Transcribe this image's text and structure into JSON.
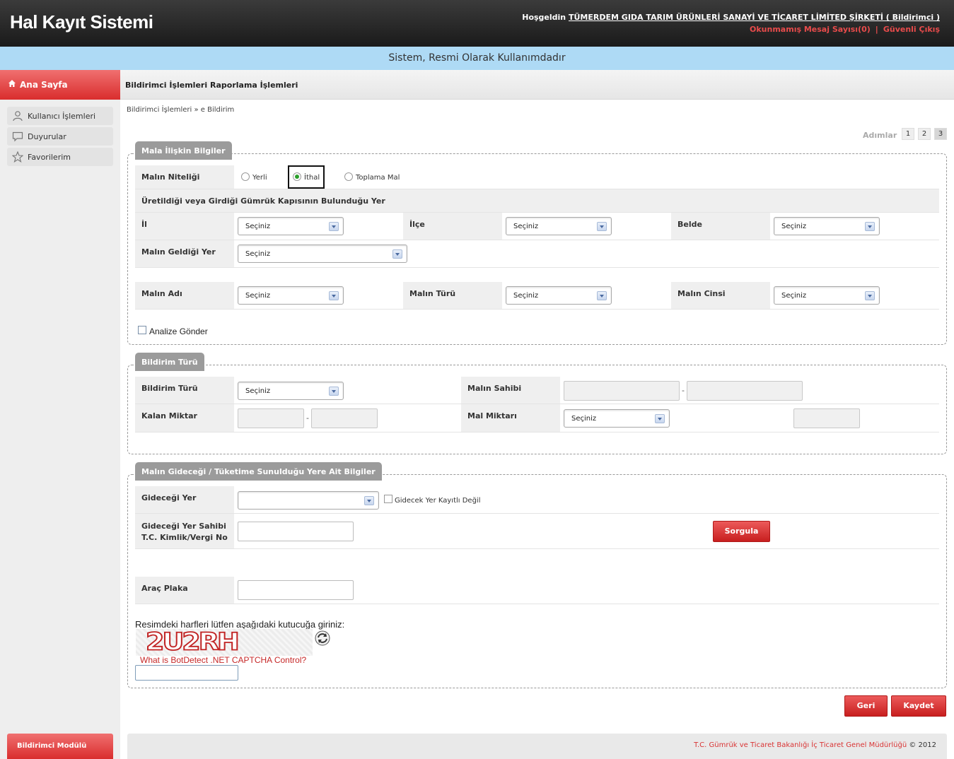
{
  "header": {
    "app_title": "Hal Kayıt Sistemi",
    "welcome_prefix": "Hoşgeldin",
    "user_name": "TÜMERDEM GIDA TARIM ÜRÜNLERİ SANAYİ VE TİCARET LİMİTED ŞİRKETİ ( Bildirimci )",
    "unread_messages": "Okunmamış Mesaj Sayısı(0)",
    "separator": "|",
    "logout": "Güvenli Çıkış"
  },
  "notice": "Sistem, Resmi Olarak Kullanımdadır",
  "sidebar": {
    "home": "Ana Sayfa",
    "items": [
      {
        "label": "Kullanıcı İşlemleri",
        "icon": "user-icon"
      },
      {
        "label": "Duyurular",
        "icon": "speech-bubble-icon"
      },
      {
        "label": "Favorilerim",
        "icon": "star-icon"
      }
    ],
    "module": "Bildirimci Modülü"
  },
  "menu": [
    "Bildirimci İşlemleri",
    "Raporlama İşlemleri"
  ],
  "breadcrumb": "Bildirimci İşlemleri » e Bildirim",
  "steps": {
    "label": "Adımlar",
    "items": [
      "1",
      "2",
      "3"
    ],
    "active": "3"
  },
  "section1": {
    "legend": "Mala İlişkin Bilgiler",
    "nitelik_label": "Malın Niteliği",
    "radios": [
      {
        "label": "Yerli",
        "checked": false
      },
      {
        "label": "İthal",
        "checked": true
      },
      {
        "label": "Toplama Mal",
        "checked": false
      }
    ],
    "subheading": "Üretildiği veya Girdiği Gümrük Kapısının Bulunduğu Yer",
    "il_label": "İl",
    "il_value": "Seçiniz",
    "ilce_label": "İlçe",
    "ilce_value": "Seçiniz",
    "belde_label": "Belde",
    "belde_value": "Seçiniz",
    "geldigi_label": "Malın Geldiği Yer",
    "geldigi_value": "Seçiniz",
    "adi_label": "Malın Adı",
    "adi_value": "Seçiniz",
    "turu_label": "Malın Türü",
    "turu_value": "Seçiniz",
    "cinsi_label": "Malın Cinsi",
    "cinsi_value": "Seçiniz",
    "analiz_label": "Analize Gönder"
  },
  "section2": {
    "legend": "Bildirim Türü",
    "bildirim_label": "Bildirim Türü",
    "bildirim_value": "Seçiniz",
    "sahibi_label": "Malın Sahibi",
    "kalan_label": "Kalan Miktar",
    "miktar_label": "Mal Miktarı",
    "miktar_value": "Seçiniz",
    "dash": "-"
  },
  "section3": {
    "legend": "Malın Gideceği / Tüketime Sunulduğu Yere Ait Bilgiler",
    "yer_label": "Gideceği Yer",
    "kayitsiz_label": "Gidecek Yer Kayıtlı Değil",
    "sahibi_label_1": "Gideceği Yer Sahibi",
    "sahibi_label_2": "T.C. Kimlik/Vergi No",
    "sorgula": "Sorgula",
    "plaka_label": "Araç Plaka",
    "captcha_prompt": "Resimdeki harfleri lütfen aşağıdaki kutucuğa giriniz:",
    "captcha_text": "2U2RH",
    "captcha_link": "What is BotDetect .NET CAPTCHA Control?"
  },
  "buttons": {
    "back": "Geri",
    "save": "Kaydet"
  },
  "footer": {
    "org": "T.C. Gümrük ve Ticaret Bakanlığı İç Ticaret Genel Müdürlüğü",
    "copyright": "© 2012"
  },
  "colors": {
    "accent_red": "#d92d2d",
    "notice_blue": "#aedaf5",
    "header_dark": "#222222"
  }
}
